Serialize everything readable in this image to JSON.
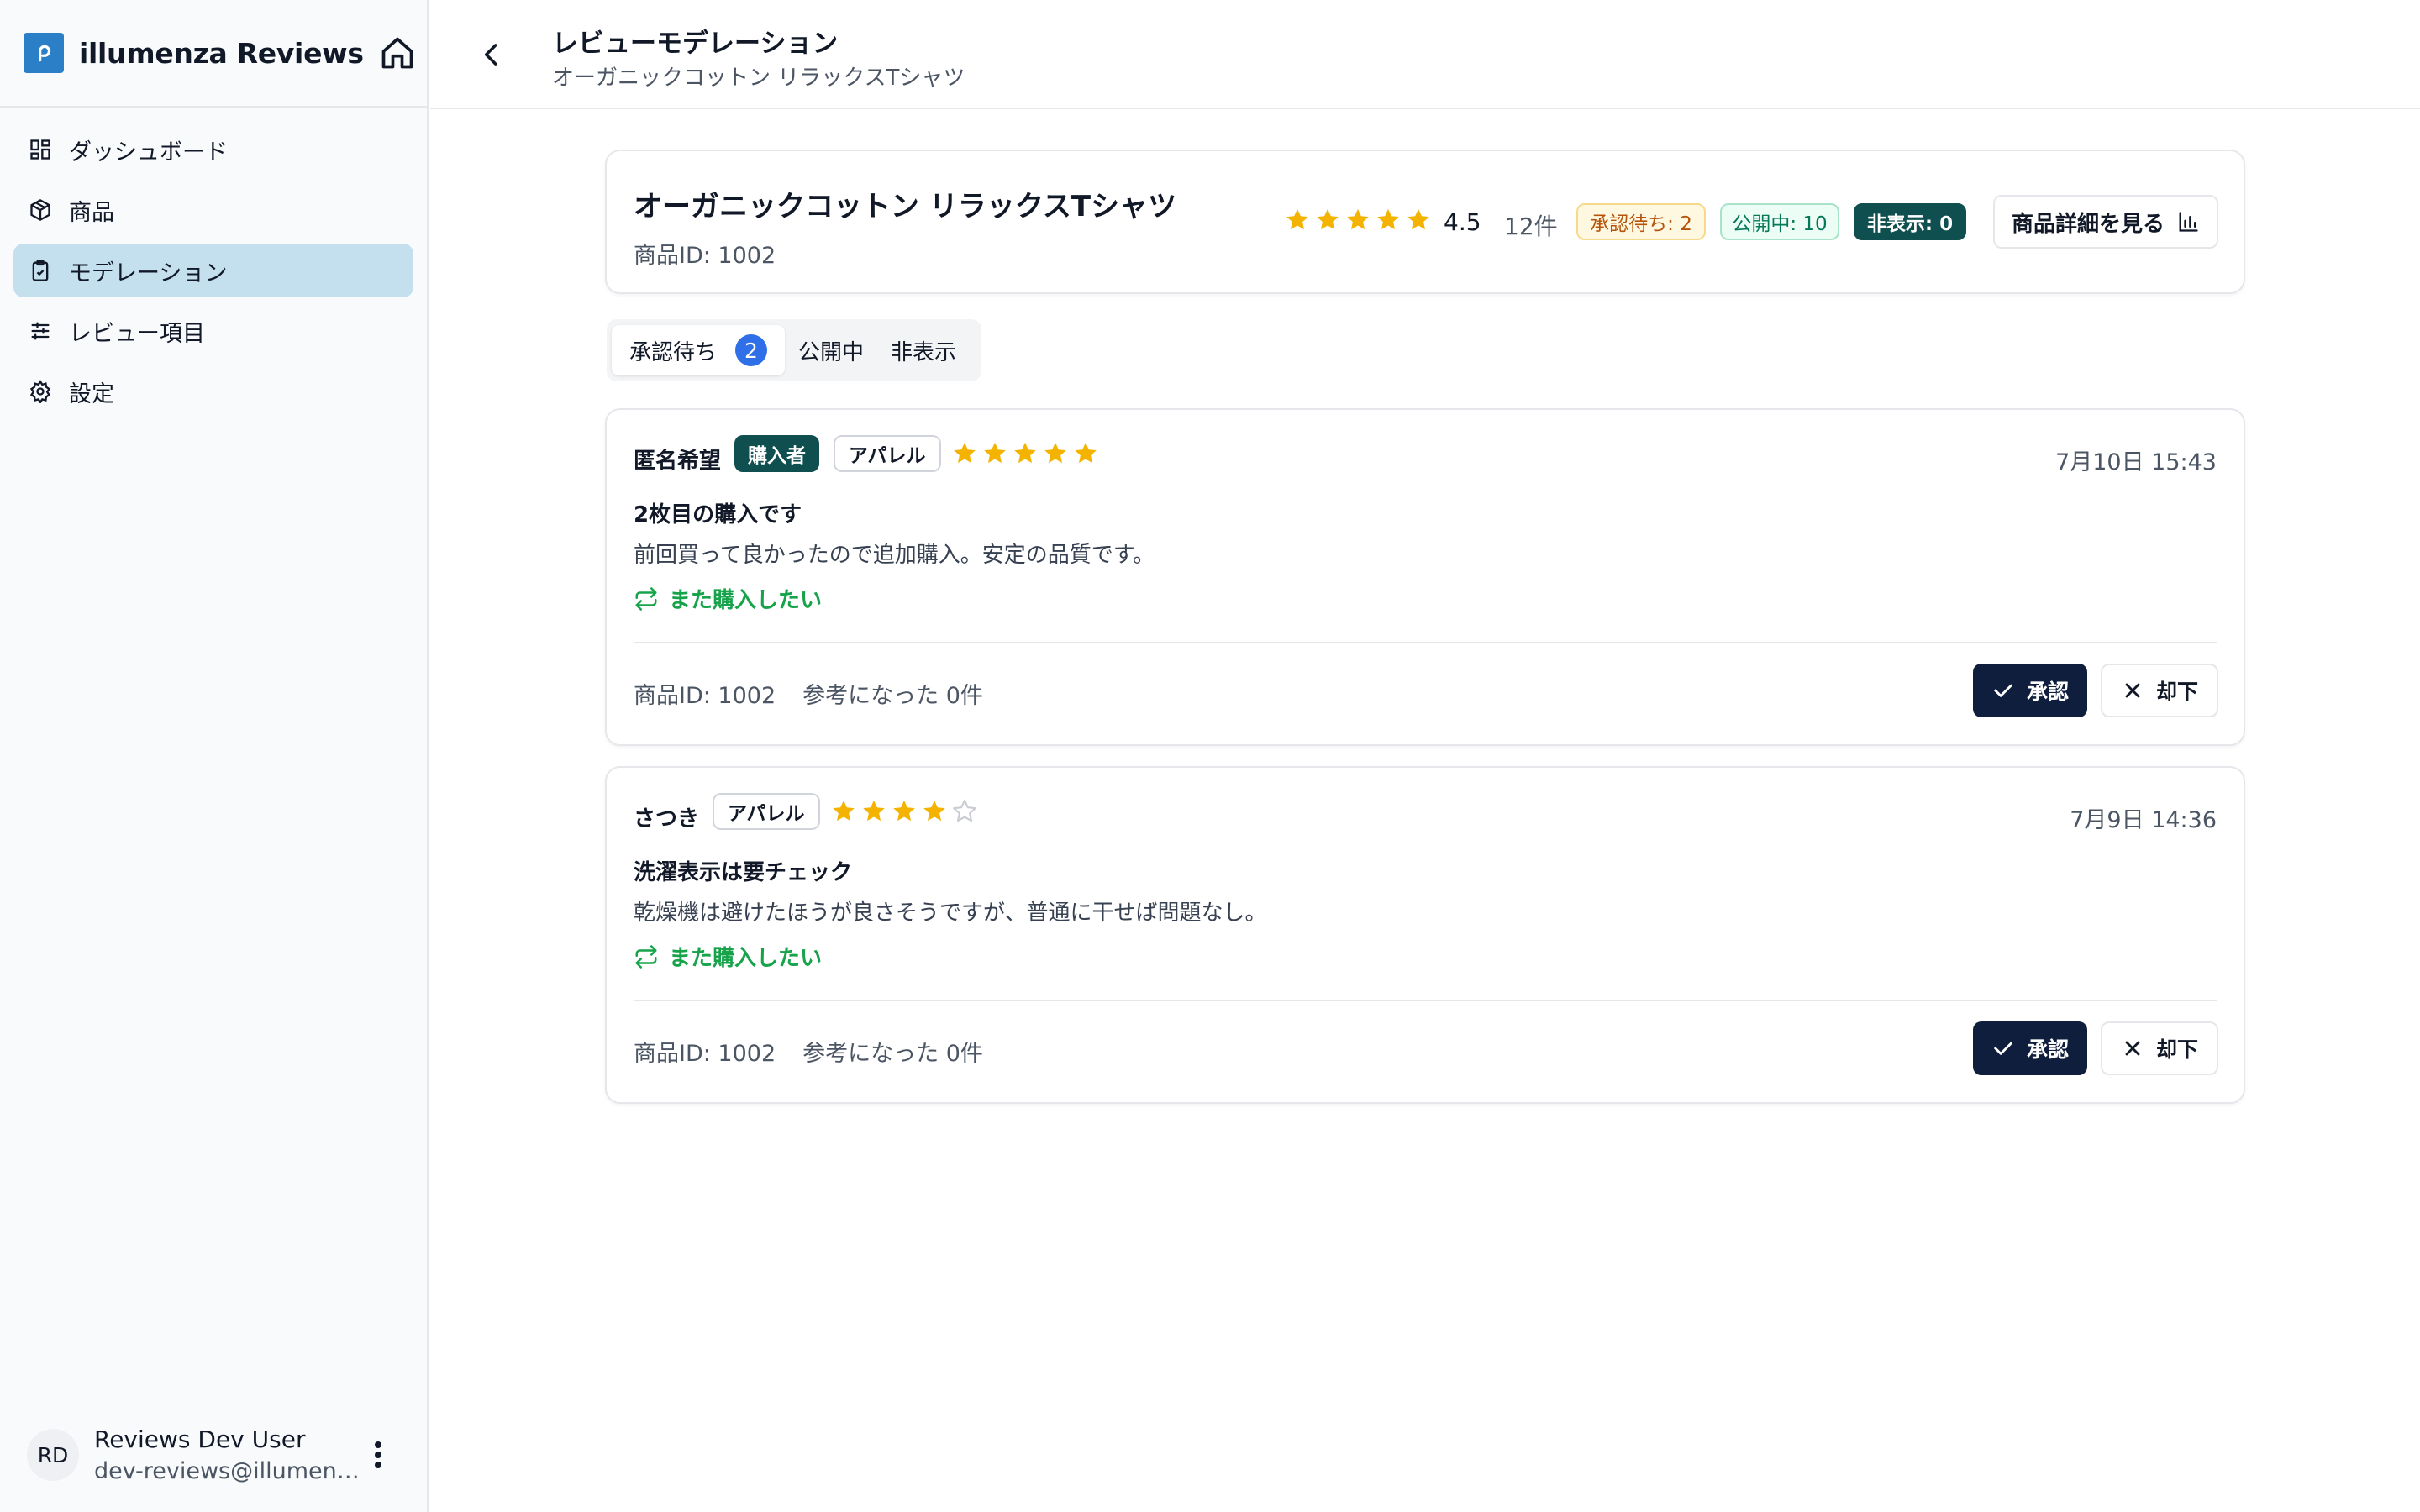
{
  "app": {
    "brand": "illumenza Reviews",
    "accent": "#2b7fc6"
  },
  "sidebar": {
    "items": [
      {
        "label": "ダッシュボード",
        "icon": "dashboard-icon"
      },
      {
        "label": "商品",
        "icon": "package-icon"
      },
      {
        "label": "モデレーション",
        "icon": "clipboard-check-icon",
        "active": true
      },
      {
        "label": "レビュー項目",
        "icon": "sliders-icon"
      },
      {
        "label": "設定",
        "icon": "gear-icon"
      }
    ],
    "user": {
      "initials": "RD",
      "name": "Reviews Dev User",
      "email": "dev-reviews@illumenz..."
    }
  },
  "header": {
    "title": "レビューモデレーション",
    "subtitle": "オーガニックコットン リラックスTシャツ"
  },
  "product": {
    "name": "オーガニックコットン リラックスTシャツ",
    "id_label": "商品ID: 1002",
    "rating": "4.5",
    "rating_stars": 5,
    "review_count": "12件",
    "badges": {
      "pending": "承認待ち: 2",
      "public": "公開中: 10",
      "hidden": "非表示: 0"
    },
    "detail_button": "商品詳細を見る"
  },
  "tabs": [
    {
      "label": "承認待ち",
      "count": "2",
      "active": true
    },
    {
      "label": "公開中"
    },
    {
      "label": "非表示"
    }
  ],
  "reviews": [
    {
      "reviewer": "匿名希望",
      "buyer_tag": "購入者",
      "category_tag": "アパレル",
      "stars": 5,
      "date": "7月10日 15:43",
      "title": "2枚目の購入です",
      "body": "前回買って良かったので追加購入。安定の品質です。",
      "rebuy": "また購入したい",
      "product_id": "商品ID: 1002",
      "helpful": "参考になった 0件",
      "approve": "承認",
      "reject": "却下"
    },
    {
      "reviewer": "さつき",
      "category_tag": "アパレル",
      "stars": 4,
      "date": "7月9日 14:36",
      "title": "洗濯表示は要チェック",
      "body": "乾燥機は避けたほうが良さそうですが、普通に干せば問題なし。",
      "rebuy": "また購入したい",
      "product_id": "商品ID: 1002",
      "helpful": "参考になった 0件",
      "approve": "承認",
      "reject": "却下"
    }
  ],
  "colors": {
    "star": "#f5b301",
    "star_empty": "#c9cdd3",
    "approve_bg": "#0f1e3d",
    "buyer_tag_bg": "#0f4f4f",
    "rebuy_text": "#16a34a"
  }
}
